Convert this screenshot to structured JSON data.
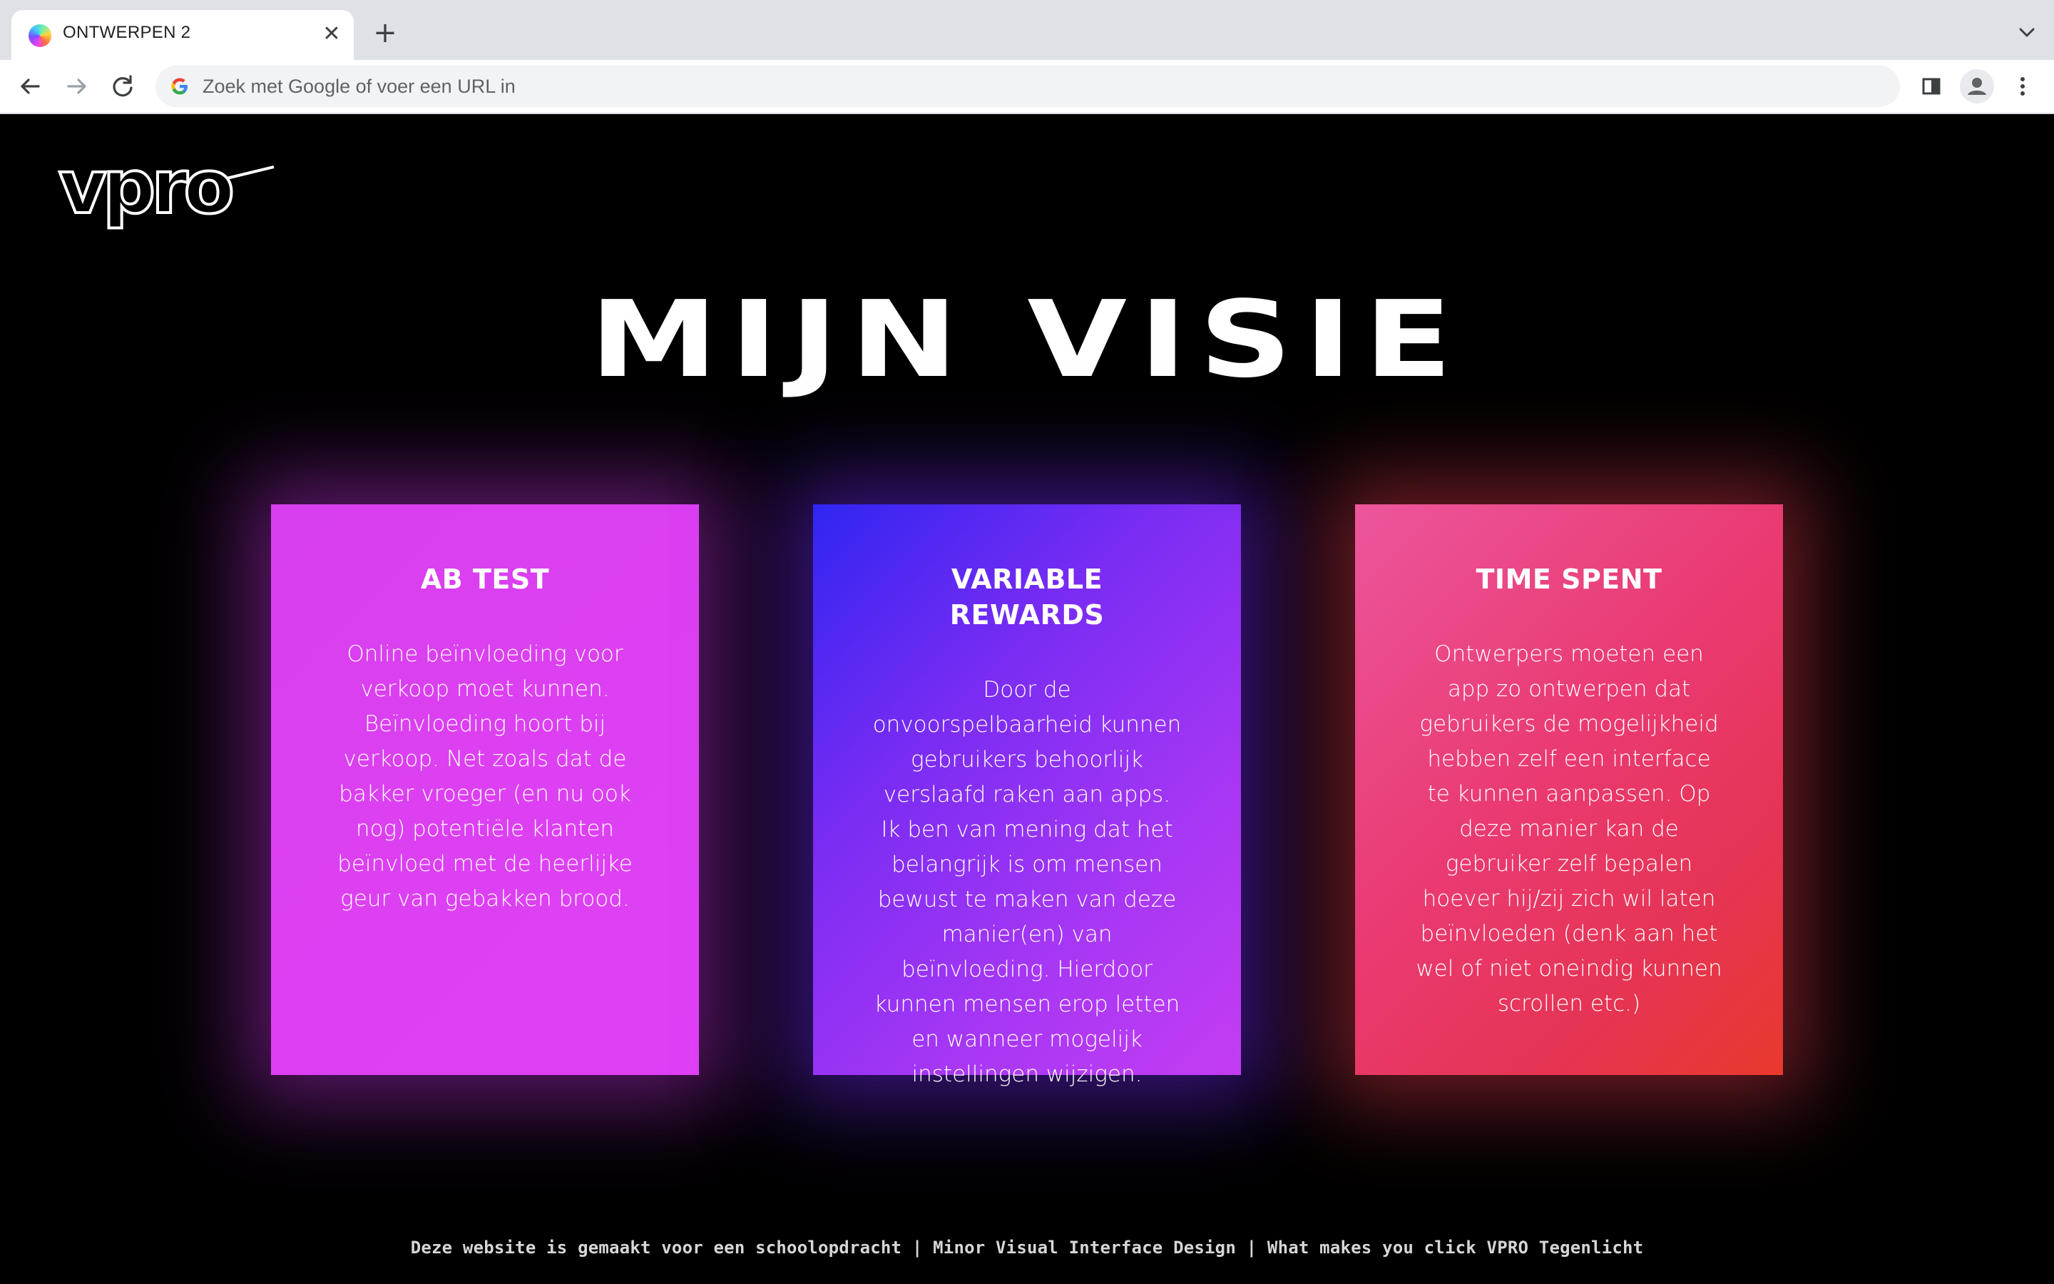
{
  "browser": {
    "tab": {
      "title": "ONTWERPEN 2",
      "favicon_icon": "color-orb-icon",
      "close_icon": "close-icon"
    },
    "new_tab_icon": "plus-icon",
    "tab_search_icon": "chevron-down-icon",
    "nav": {
      "back_icon": "arrow-left-icon",
      "forward_icon": "arrow-right-icon",
      "reload_icon": "reload-icon"
    },
    "omnibox": {
      "placeholder": "Zoek met Google of voer een URL in",
      "icon": "google-icon"
    },
    "toolbar_icons": [
      "side-panel-icon",
      "profile-icon",
      "kebab-menu-icon"
    ]
  },
  "page": {
    "logo_text": "vpro",
    "title": "MIJN VISIE",
    "cards": [
      {
        "title": "AB TEST",
        "text": "Online beïnvloeding voor verkoop moet kunnen. Beïnvloeding hoort bij verkoop. Net zoals dat de bakker vroeger (en nu ook nog) potentiële klanten beïnvloed met de heerlijke geur van gebakken brood.",
        "color": "#dd3ff2"
      },
      {
        "title": "VARIABLE REWARDS",
        "text": "Door de onvoorspelbaarheid kunnen gebruikers behoorlijk verslaafd raken aan apps. Ik ben van mening dat het belangrijk is om mensen bewust te maken van deze manier(en) van beïnvloeding. Hierdoor kunnen mensen erop letten en wanneer mogelijk instellingen wijzigen.",
        "color": "#7a2cf3"
      },
      {
        "title": "TIME SPENT",
        "text": "Ontwerpers moeten een app zo ontwerpen dat gebruikers de mogelijkheid hebben zelf een interface te kunnen aanpassen. Op deze manier kan de gebruiker zelf bepalen hoever hij/zij zich wil laten beïnvloeden (denk aan het wel of niet oneindig kunnen scrollen etc.)",
        "color": "#ea3a68"
      }
    ],
    "footer": "Deze website is gemaakt voor een schoolopdracht | Minor Visual Interface Design | What makes you click VPRO Tegenlicht"
  }
}
